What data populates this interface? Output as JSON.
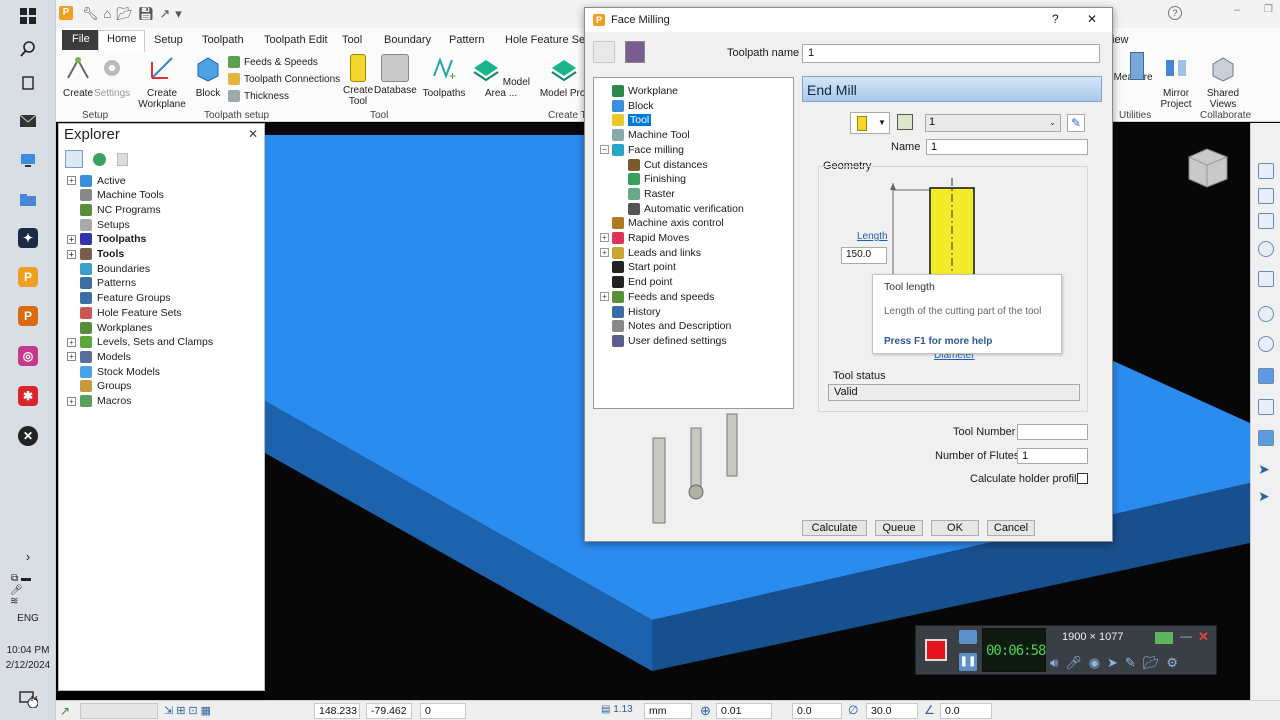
{
  "taskbar": {
    "lang": "ENG",
    "time": "10:04 PM",
    "date": "2/12/2024",
    "notif_count": "14"
  },
  "ribbon": {
    "tabs": [
      "File",
      "Home",
      "Setup",
      "Toolpath",
      "Toolpath Edit",
      "Tool",
      "Boundary",
      "Pattern",
      "Hole Feature Set"
    ],
    "partial_tab": "iew",
    "buttons": {
      "create": "Create",
      "settings": "Settings",
      "create_workplane": "Create Workplane",
      "block": "Block",
      "create_tool": "Create Tool",
      "database": "Database",
      "toolpaths": "Toolpaths",
      "model_area": "Model Area ...",
      "model_prof": "Model Prof",
      "measure": "r Measure",
      "mirror_project": "Mirror Project",
      "shared_views": "Shared Views"
    },
    "small": {
      "feeds_speeds": "Feeds & Speeds",
      "toolpath_connections": "Toolpath Connections",
      "thickness": "Thickness"
    },
    "groups": {
      "setup": "Setup",
      "toolpath_setup": "Toolpath setup",
      "tool": "Tool",
      "create_t": "Create T",
      "utilities": "Utilities",
      "collaborate": "Collaborate"
    }
  },
  "explorer": {
    "title": "Explorer",
    "items": [
      {
        "label": "Active",
        "exp": "+",
        "bold": false
      },
      {
        "label": "Machine Tools",
        "exp": "",
        "bold": false
      },
      {
        "label": "NC Programs",
        "exp": "",
        "bold": false
      },
      {
        "label": "Setups",
        "exp": "",
        "bold": false
      },
      {
        "label": "Toolpaths",
        "exp": "+",
        "bold": true
      },
      {
        "label": "Tools",
        "exp": "+",
        "bold": true
      },
      {
        "label": "Boundaries",
        "exp": "",
        "bold": false
      },
      {
        "label": "Patterns",
        "exp": "",
        "bold": false
      },
      {
        "label": "Feature Groups",
        "exp": "",
        "bold": false
      },
      {
        "label": "Hole Feature Sets",
        "exp": "",
        "bold": false
      },
      {
        "label": "Workplanes",
        "exp": "",
        "bold": false
      },
      {
        "label": "Levels, Sets and Clamps",
        "exp": "+",
        "bold": false
      },
      {
        "label": "Models",
        "exp": "+",
        "bold": false
      },
      {
        "label": "Stock Models",
        "exp": "",
        "bold": false
      },
      {
        "label": "Groups",
        "exp": "",
        "bold": false
      },
      {
        "label": "Macros",
        "exp": "+",
        "bold": false
      }
    ]
  },
  "dialog": {
    "title": "Face Milling",
    "help": "?",
    "close": "✕",
    "toolpath_name_label": "Toolpath name",
    "toolpath_name_value": "1",
    "tree": [
      {
        "label": "Workplane",
        "level": 0,
        "exp": ""
      },
      {
        "label": "Block",
        "level": 0,
        "exp": ""
      },
      {
        "label": "Tool",
        "level": 0,
        "exp": "",
        "selected": true
      },
      {
        "label": "Machine Tool",
        "level": 0,
        "exp": ""
      },
      {
        "label": "Face milling",
        "level": 0,
        "exp": "−"
      },
      {
        "label": "Cut distances",
        "level": 1,
        "exp": ""
      },
      {
        "label": "Finishing",
        "level": 1,
        "exp": ""
      },
      {
        "label": "Raster",
        "level": 1,
        "exp": ""
      },
      {
        "label": "Automatic verification",
        "level": 1,
        "exp": ""
      },
      {
        "label": "Machine axis control",
        "level": 0,
        "exp": ""
      },
      {
        "label": "Rapid Moves",
        "level": 0,
        "exp": "+"
      },
      {
        "label": "Leads and links",
        "level": 0,
        "exp": "+"
      },
      {
        "label": "Start point",
        "level": 0,
        "exp": ""
      },
      {
        "label": "End point",
        "level": 0,
        "exp": ""
      },
      {
        "label": "Feeds and speeds",
        "level": 0,
        "exp": "+"
      },
      {
        "label": "History",
        "level": 0,
        "exp": ""
      },
      {
        "label": "Notes and Description",
        "level": 0,
        "exp": ""
      },
      {
        "label": "User defined settings",
        "level": 0,
        "exp": ""
      }
    ],
    "section_title": "End Mill",
    "tool_select": "1",
    "name_label": "Name",
    "name_value": "1",
    "geometry_label": "Geometry",
    "length_link": "Length",
    "length_value": "150.0",
    "diameter_link": "Diameter",
    "tool_status_label": "Tool status",
    "tool_status_value": "Valid",
    "tool_number_label": "Tool Number",
    "tool_number_value": "",
    "flutes_label": "Number of Flutes",
    "flutes_value": "1",
    "holder_profile_label": "Calculate holder profile",
    "buttons": {
      "calculate": "Calculate",
      "queue": "Queue",
      "ok": "OK",
      "cancel": "Cancel"
    }
  },
  "tooltip": {
    "title": "Tool length",
    "body": "Length of the cutting part of the tool",
    "help": "Press F1 for more help"
  },
  "recorder": {
    "resolution": "1900 × 1077",
    "timer": "00:06:58"
  },
  "status": {
    "x": "148.233",
    "y": "-79.462",
    "z": "0",
    "unit": "mm",
    "tol": "0.01",
    "f1": "0.0",
    "angle": "30.0",
    "f2": "0.0"
  },
  "colors": {
    "block_top": "#2b8cf0",
    "block_side": "#1d62ad",
    "accent": "#0078d7",
    "end_mill_header": "#b9d3ee"
  }
}
